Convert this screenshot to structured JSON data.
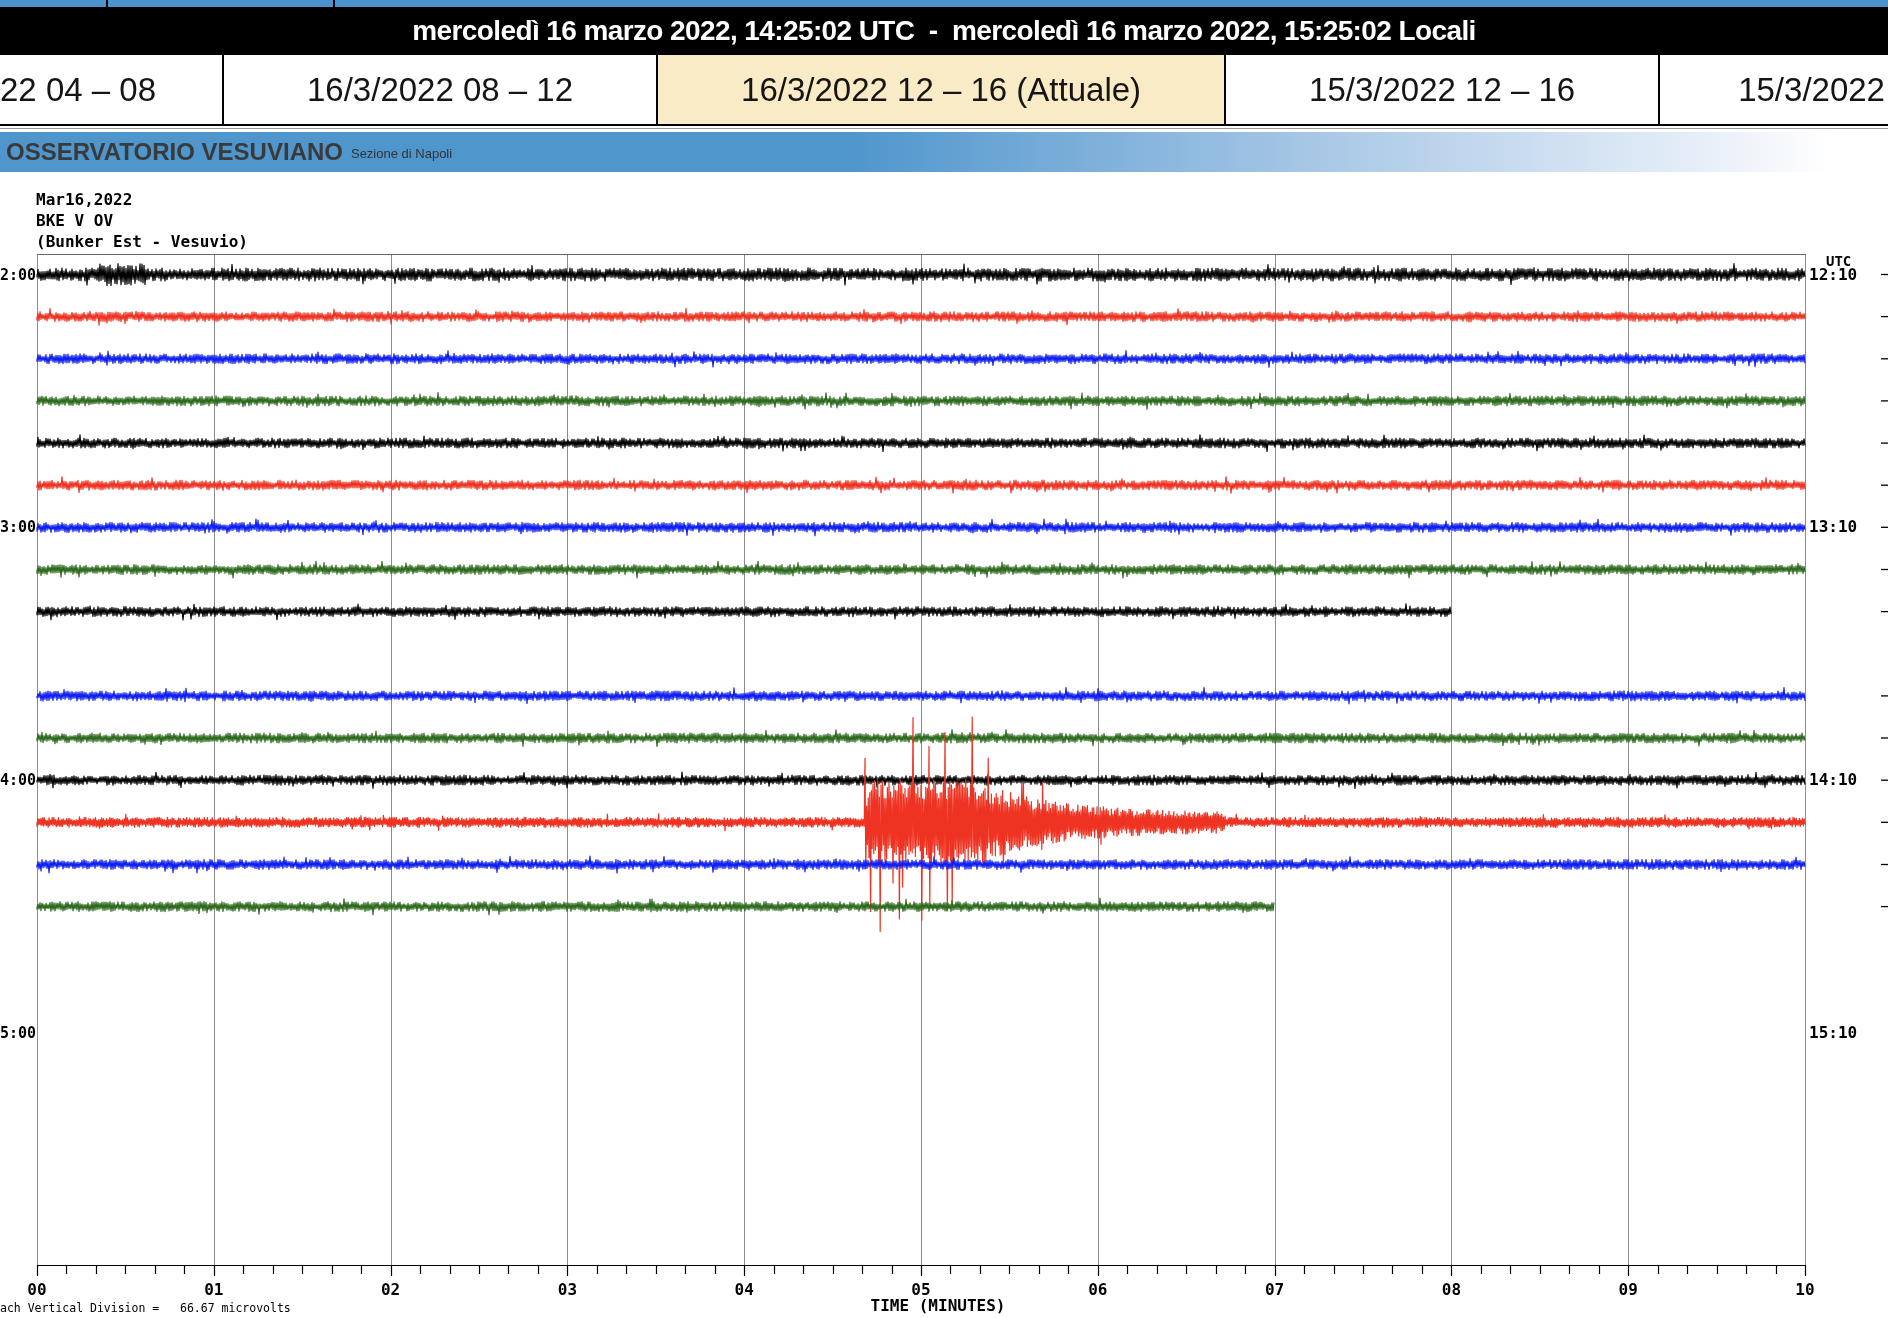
{
  "header": {
    "text": "mercoledì 16 marzo 2022, 14:25:02 UTC  -  mercoledì 16 marzo 2022, 15:25:02 Locali"
  },
  "tabs": [
    {
      "label": "22 04 – 08",
      "selected": false
    },
    {
      "label": "16/3/2022 08 – 12",
      "selected": false
    },
    {
      "label": "16/3/2022 12 – 16 (Attuale)",
      "selected": true
    },
    {
      "label": "15/3/2022 12 – 16",
      "selected": false
    },
    {
      "label": "15/3/2022",
      "selected": false
    }
  ],
  "banner": {
    "title": "OSSERVATORIO VESUVIANO",
    "subtitle": "Sezione di Napoli"
  },
  "seismogram": {
    "date": "Mar16,2022",
    "station": "BKE V OV",
    "location": "(Bunker Est - Vesuvio)",
    "timezone": "UTC",
    "hours": [
      {
        "left_label": "2:00",
        "right_label": "12:10",
        "traces": [
          {
            "kind": "noisy",
            "color": "#000000",
            "level": 1
          },
          {
            "kind": "noise",
            "color": "#ee3322",
            "level": 1
          },
          {
            "kind": "noise",
            "color": "#1020f0",
            "level": 1
          },
          {
            "kind": "noise",
            "color": "#2e6b1f",
            "level": 1
          },
          {
            "kind": "noise",
            "color": "#000000",
            "level": 1
          },
          {
            "kind": "noise",
            "color": "#ee3322",
            "level": 1
          }
        ]
      },
      {
        "left_label": "3:00",
        "right_label": "13:10",
        "traces": [
          {
            "kind": "noise",
            "color": "#1020f0",
            "level": 1
          },
          {
            "kind": "noise",
            "color": "#2e6b1f",
            "level": 1
          },
          {
            "kind": "noise",
            "color": "#000000",
            "level": 0.8
          },
          {
            "kind": "gap"
          },
          {
            "kind": "noise",
            "color": "#1020f0",
            "level": 1
          },
          {
            "kind": "noise",
            "color": "#2e6b1f",
            "level": 1
          }
        ]
      },
      {
        "left_label": "4:00",
        "right_label": "14:10",
        "traces": [
          {
            "kind": "noise",
            "color": "#000000",
            "level": 1
          },
          {
            "kind": "event",
            "color": "#ee3322",
            "level": 1
          },
          {
            "kind": "noise",
            "color": "#1020f0",
            "level": 1
          },
          {
            "kind": "noise",
            "color": "#2e6b1f",
            "level": 0.7
          }
        ]
      },
      {
        "left_label": "5:00",
        "right_label": "15:10"
      }
    ],
    "x_labels": [
      "00",
      "01",
      "02",
      "03",
      "04",
      "05",
      "06",
      "07",
      "08",
      "09",
      "10"
    ],
    "x_title": "TIME (MINUTES)",
    "scale_note": "ach Vertical Division =   66.67 microvolts"
  }
}
